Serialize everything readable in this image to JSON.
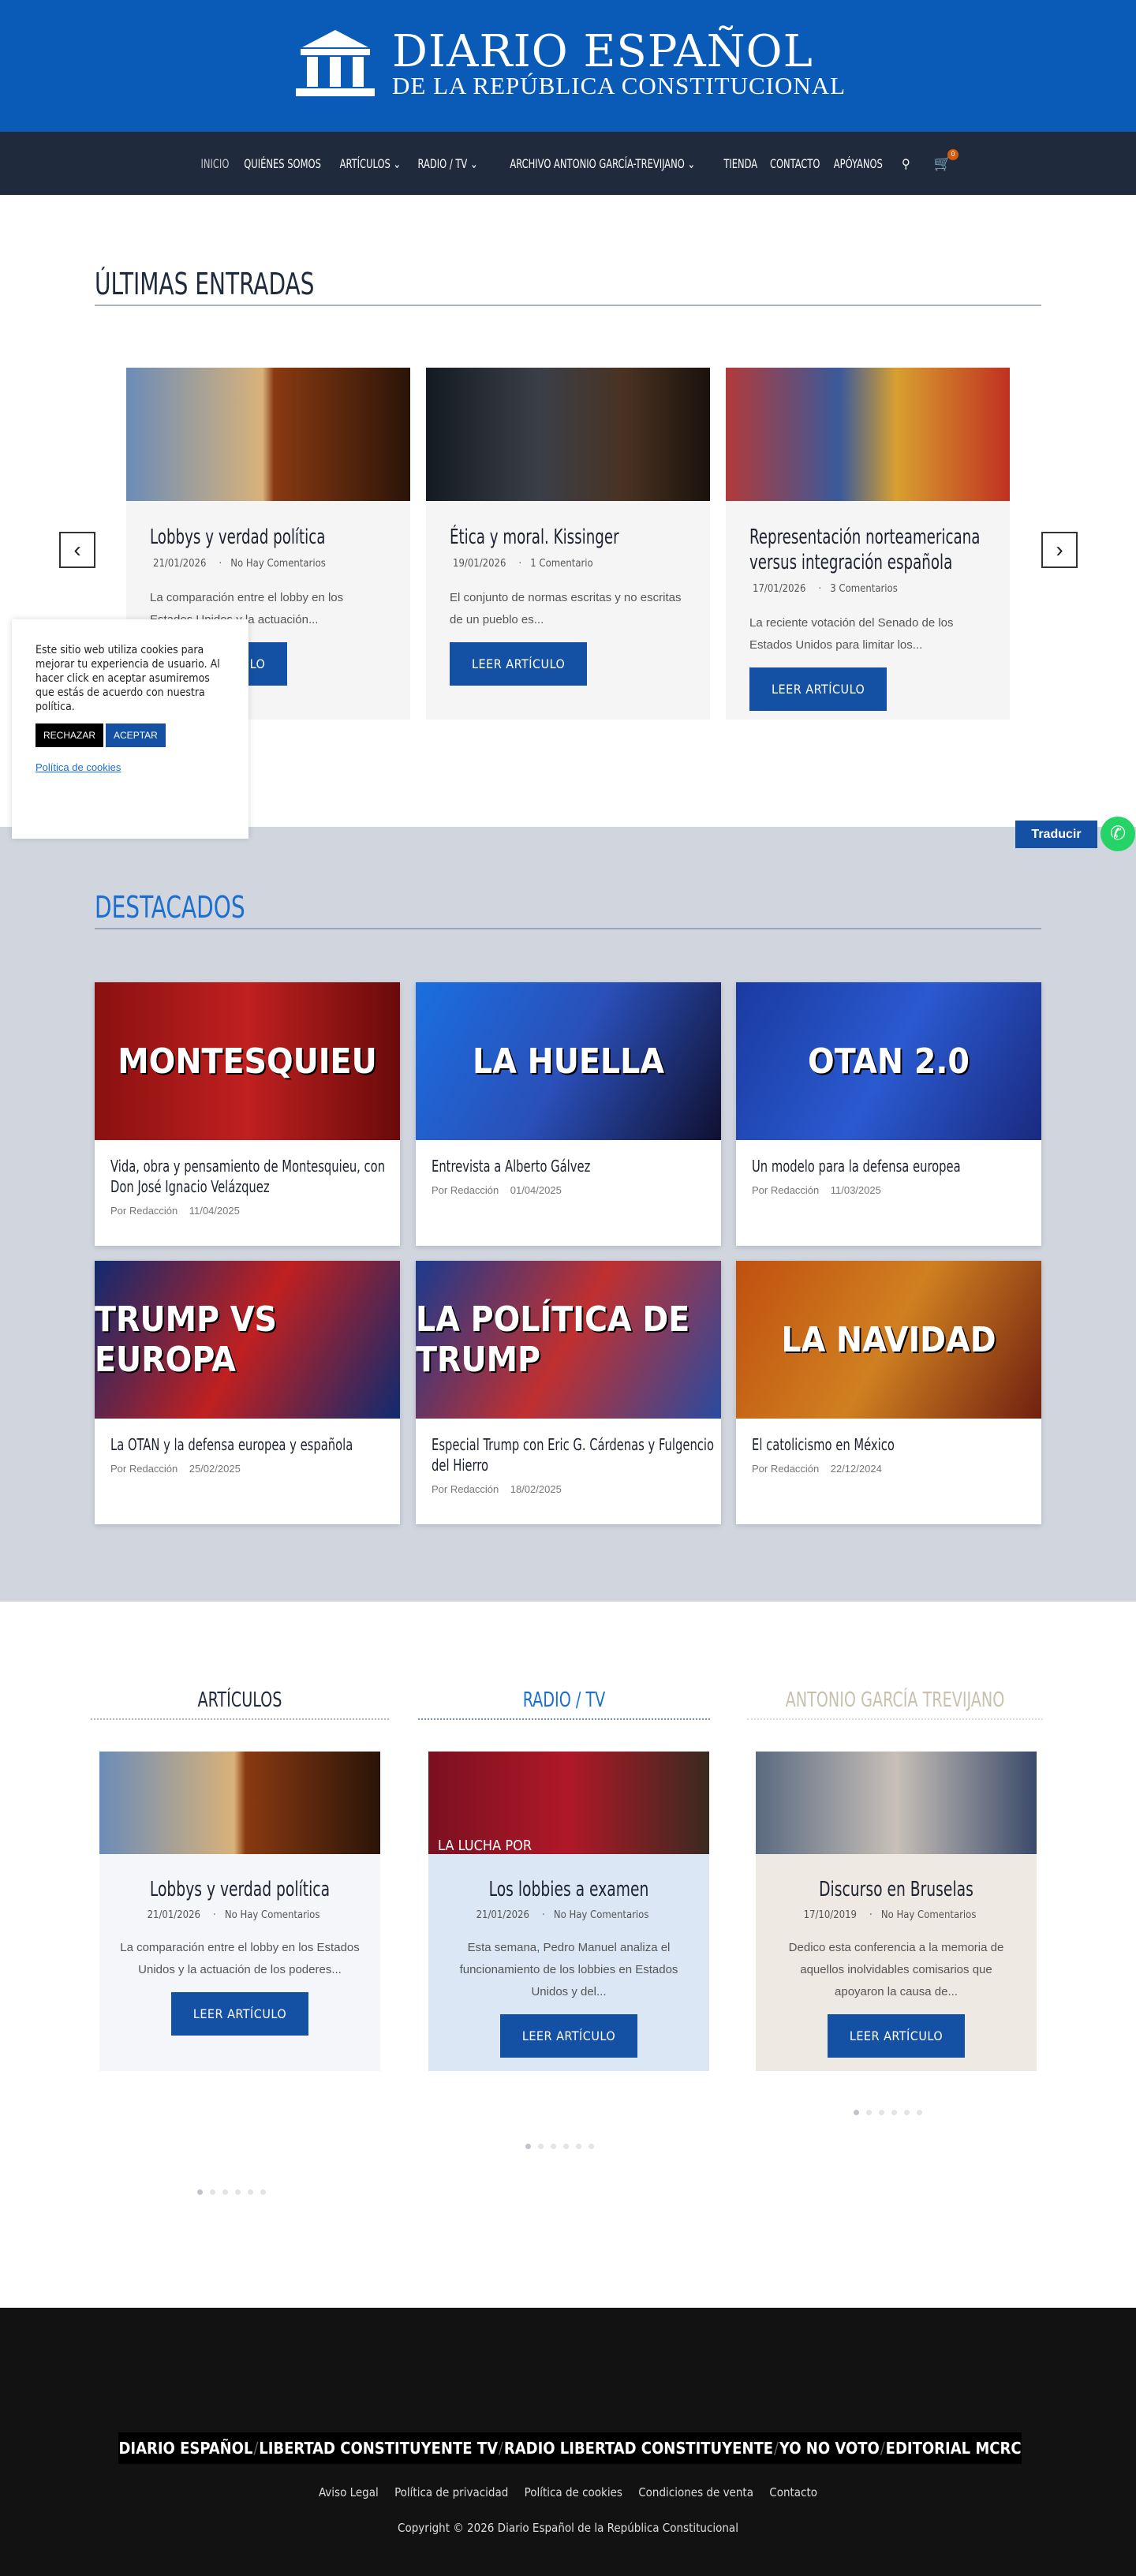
{
  "header": {
    "title": "DIARIO ESPAÑOL",
    "subtitle": "DE LA REPÚBLICA CONSTITUCIONAL"
  },
  "nav": {
    "items": [
      {
        "label": "Inicio"
      },
      {
        "label": "Quiénes somos"
      },
      {
        "label": "Artículos ⌄"
      },
      {
        "label": "Radio / TV ⌄"
      },
      {
        "label": "Archivo Antonio García-Trevijano ⌄"
      },
      {
        "label": "Tienda"
      },
      {
        "label": "Contacto"
      },
      {
        "label": "Apóyanos"
      }
    ],
    "cart_count": "0"
  },
  "latest": {
    "title": "ÚLTIMAS ENTRADAS",
    "read_more": "LEER ARTÍCULO",
    "posts": [
      {
        "title": "Lobbys y verdad política",
        "date": "21/01/2026",
        "comments": "No Hay Comentarios",
        "excerpt": "La comparación entre el lobby en los Estados Unidos y la actuación..."
      },
      {
        "title": "Ética y moral. Kissinger",
        "date": "19/01/2026",
        "comments": "1 Comentario",
        "excerpt": "El conjunto de normas escritas y no escritas de un pueblo es..."
      },
      {
        "title": "Representación norteamericana versus integración española",
        "date": "17/01/2026",
        "comments": "3 Comentarios",
        "excerpt": "La reciente votación del Senado de los Estados Unidos para limitar los..."
      }
    ]
  },
  "cookie": {
    "text": "Este sitio web utiliza cookies para mejorar tu experiencia de usuario. Al hacer click en aceptar asumiremos que estás de acuerdo con nuestra política.",
    "reject": "RECHAZAR",
    "accept": "ACEPTAR",
    "policy": "Política de cookies"
  },
  "translate": "Traducir",
  "featured": {
    "title": "DESTACADOS",
    "posts": [
      {
        "title": "Vida, obra y pensamiento de Montesquieu, con Don José Ignacio Velázquez",
        "author": "Por Redacción",
        "date": "11/04/2025",
        "image_text": "MONTESQUIEU"
      },
      {
        "title": "Entrevista a Alberto Gálvez",
        "author": "Por Redacción",
        "date": "01/04/2025",
        "image_text": "LA HUELLA"
      },
      {
        "title": "Un modelo para la defensa europea",
        "author": "Por Redacción",
        "date": "11/03/2025",
        "image_text": "OTAN 2.0"
      },
      {
        "title": "La OTAN y la defensa europea y española",
        "author": "Por Redacción",
        "date": "25/02/2025",
        "image_text": "TRUMP VS EUROPA"
      },
      {
        "title": "Especial Trump con Eric G. Cárdenas y Fulgencio del Hierro",
        "author": "Por Redacción",
        "date": "18/02/2025",
        "image_text": "LA POLÍTICA DE TRUMP"
      },
      {
        "title": "El catolicismo en México",
        "author": "Por Redacción",
        "date": "22/12/2024",
        "image_text": "LA NAVIDAD"
      }
    ]
  },
  "columns": [
    {
      "heading": "ARTÍCULOS",
      "title": "Lobbys y verdad política",
      "date": "21/01/2026",
      "comments": "No Hay Comentarios",
      "excerpt": "La comparación entre el lobby en los Estados Unidos y la actuación de los poderes...",
      "button": "LEER ARTÍCULO"
    },
    {
      "heading": "RADIO / TV",
      "title": "Los lobbies a examen",
      "date": "21/01/2026",
      "comments": "No Hay Comentarios",
      "excerpt": "Esta semana, Pedro Manuel analiza el funcionamiento de los lobbies en Estados Unidos y del...",
      "button": "LEER ARTÍCULO",
      "image_text": "LA LUCHA POR"
    },
    {
      "heading": "ANTONIO GARCÍA TREVIJANO",
      "title": "Discurso en Bruselas",
      "date": "17/10/2019",
      "comments": "No Hay Comentarios",
      "excerpt": "Dedico esta conferencia a la memoria de aquellos inolvidables comisarios que apoyaron la causa de...",
      "button": "LEER ARTÍCULO"
    }
  ],
  "colors": {
    "header": "#0a5bb8",
    "nav": "#1f2a3c",
    "button": "#1450a3",
    "featured_title": "#1a6fd1",
    "footer": "#121212"
  },
  "footer": {
    "logos": [
      "DIARIO ESPAÑOL",
      "LIBERTAD CONSTITUYENTE TV",
      "RADIO LIBERTAD CONSTITUYENTE",
      "YO NO VOTO",
      "EDITORIAL MCRC"
    ],
    "links": [
      "Aviso Legal",
      "Política de privacidad",
      "Política de cookies",
      "Condiciones de venta",
      "Contacto"
    ],
    "copyright": "Copyright © 2026 Diario Español de la República Constitucional"
  }
}
